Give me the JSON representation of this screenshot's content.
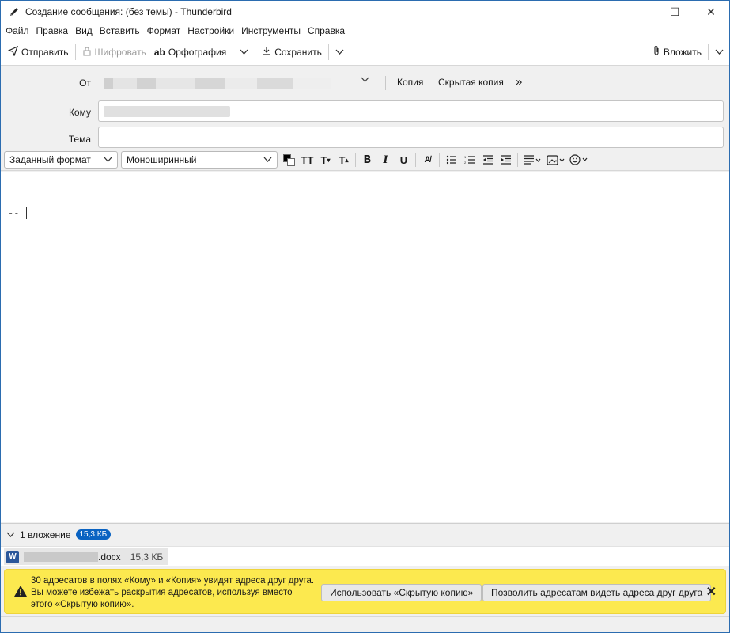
{
  "window": {
    "title": "Создание сообщения: (без темы) - Thunderbird",
    "minimize": "—",
    "maximize": "☐",
    "close": "✕"
  },
  "menu": [
    {
      "label": "Файл"
    },
    {
      "label": "Правка"
    },
    {
      "label": "Вид"
    },
    {
      "label": "Вставить"
    },
    {
      "label": "Формат"
    },
    {
      "label": "Настройки"
    },
    {
      "label": "Инструменты"
    },
    {
      "label": "Справка"
    }
  ],
  "toolbar": {
    "send": "Отправить",
    "encrypt": "Шифровать",
    "spelling": "Орфография",
    "save": "Сохранить",
    "attach": "Вложить"
  },
  "headers": {
    "from_label": "От",
    "to_label": "Кому",
    "subject_label": "Тема",
    "cc_link": "Копия",
    "bcc_link": "Скрытая копия",
    "more": "»",
    "subject_value": ""
  },
  "format": {
    "paragraph": "Заданный формат",
    "font": "Моноширинный",
    "bold": "B",
    "italic": "I",
    "underline": "U"
  },
  "editor": {
    "signature": "--"
  },
  "attachments": {
    "summary": "1 вложение",
    "total_size": "15,3 КБ",
    "items": [
      {
        "ext": ".docx",
        "size": "15,3 КБ"
      }
    ]
  },
  "notification": {
    "text": "30 адресатов в полях «Кому» и «Копия» увидят адреса друг друга. Вы можете избежать раскрытия адресатов, используя вместо этого «Скрытую копию».",
    "use_bcc": "Использовать «Скрытую копию»",
    "allow": "Позволить адресатам видеть адреса друг друга"
  }
}
